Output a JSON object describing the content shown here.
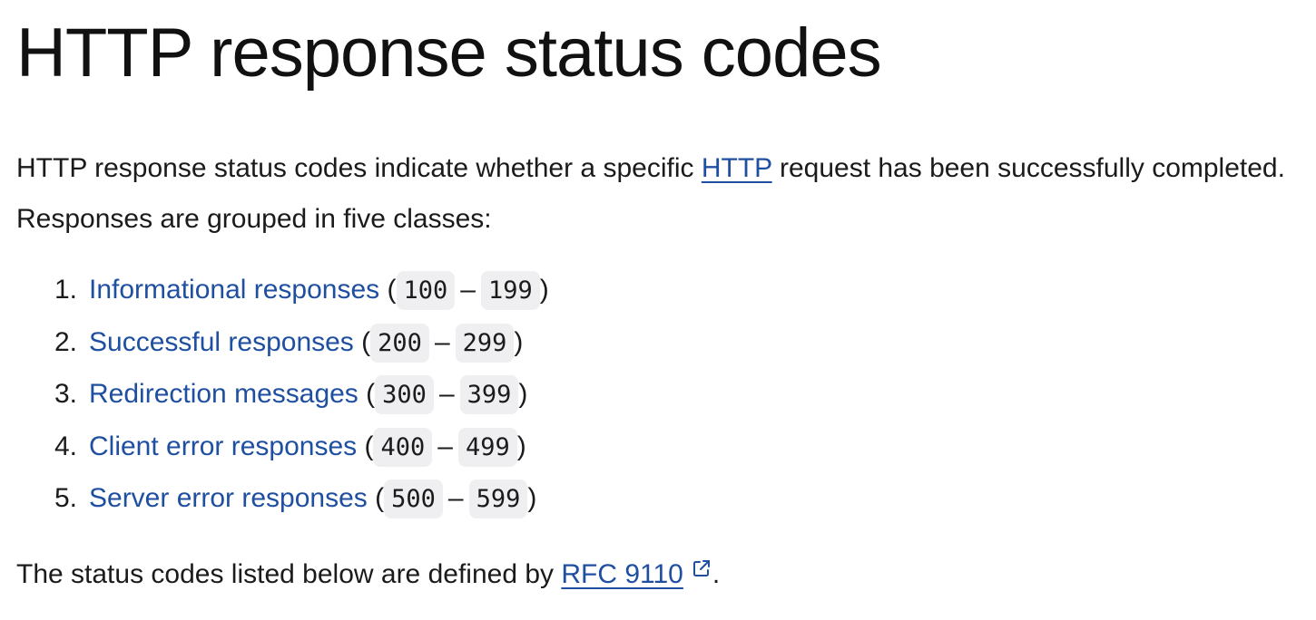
{
  "title": "HTTP response status codes",
  "intro": {
    "before": "HTTP response status codes indicate whether a specific ",
    "link": "HTTP",
    "after": " request has been successfully completed. Responses are grouped in five classes:"
  },
  "classes": [
    {
      "num": "1.",
      "label": "Informational responses",
      "start": "100",
      "end": "199"
    },
    {
      "num": "2.",
      "label": "Successful responses",
      "start": "200",
      "end": "299"
    },
    {
      "num": "3.",
      "label": "Redirection messages",
      "start": "300",
      "end": "399"
    },
    {
      "num": "4.",
      "label": "Client error responses",
      "start": "400",
      "end": "499"
    },
    {
      "num": "5.",
      "label": "Server error responses",
      "start": "500",
      "end": "599"
    }
  ],
  "footer": {
    "before": "The status codes listed below are defined by ",
    "link": "RFC 9110",
    "after": ".",
    "icon": "external-link-icon"
  },
  "punctuation": {
    "open": "(",
    "dash": "–",
    "close": ")"
  },
  "colors": {
    "link": "#1f4fa0",
    "code_bg": "#efeff1"
  }
}
